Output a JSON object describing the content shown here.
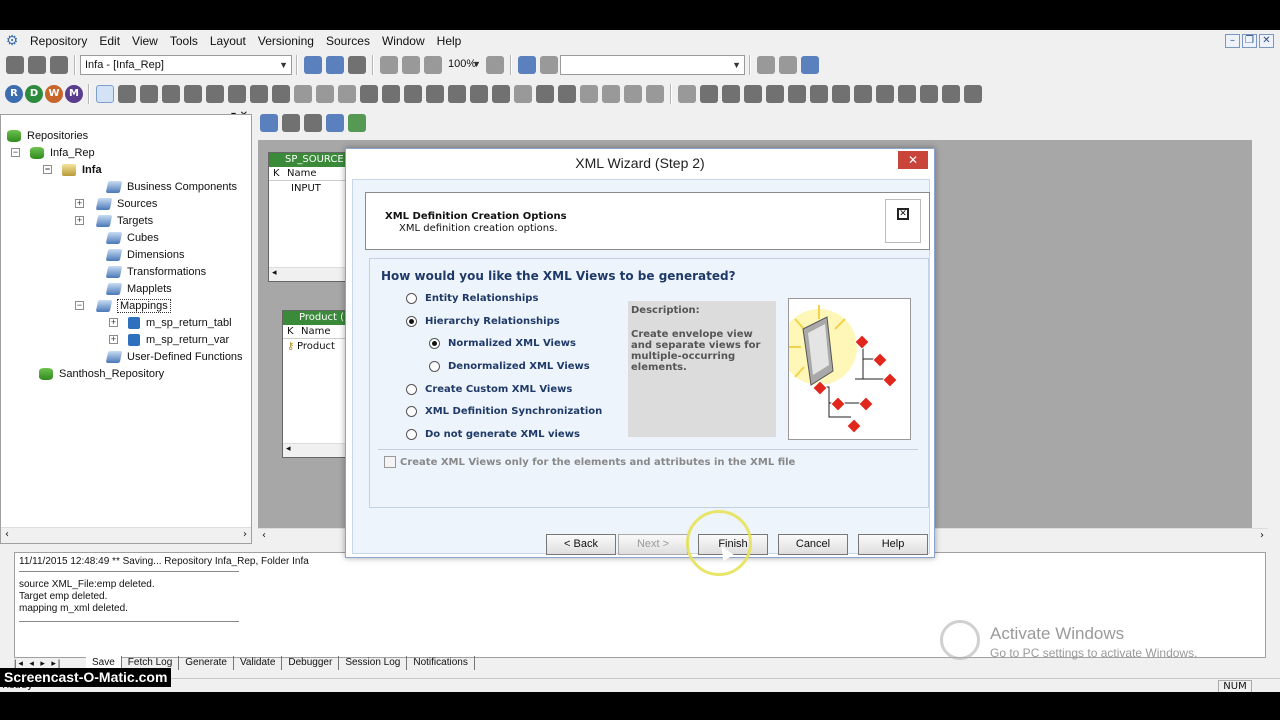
{
  "menubar": {
    "items": [
      "Repository",
      "Edit",
      "View",
      "Tools",
      "Layout",
      "Versioning",
      "Sources",
      "Window",
      "Help"
    ]
  },
  "toolbar": {
    "repo_combo": "Infa - [Infa_Rep]",
    "zoom": "100%",
    "circle_buttons": [
      "R",
      "D",
      "W",
      "M"
    ],
    "circle_colors": [
      "#3b6db0",
      "#2e8b3e",
      "#c8652a",
      "#5a3d8c"
    ]
  },
  "tree": {
    "root": "Repositories",
    "repo": "Infa_Rep",
    "folder": "Infa",
    "items": [
      "Business Components",
      "Sources",
      "Targets",
      "Cubes",
      "Dimensions",
      "Transformations",
      "Mapplets",
      "Mappings"
    ],
    "mappings": [
      "m_sp_return_tabl",
      "m_sp_return_var"
    ],
    "udf": "User-Defined Functions",
    "repo2": "Santhosh_Repository"
  },
  "workspace": {
    "src1_title": "SP_SOURCE",
    "src1_col_k": "K",
    "src1_col_name": "Name",
    "src1_row": "INPUT",
    "src2_title": "Product (",
    "src2_col_k": "K",
    "src2_col_name": "Name",
    "src2_row": "Product"
  },
  "dialog": {
    "title": "XML Wizard (Step 2)",
    "header_title": "XML Definition Creation Options",
    "header_sub": "XML definition creation options.",
    "question": "How would you like the XML Views to be generated?",
    "options": [
      {
        "label": "Entity Relationships",
        "checked": false
      },
      {
        "label": "Hierarchy Relationships",
        "checked": true
      },
      {
        "label": "Normalized XML Views",
        "checked": true
      },
      {
        "label": "Denormalized XML Views",
        "checked": false
      },
      {
        "label": "Create Custom XML Views",
        "checked": false
      },
      {
        "label": "XML Definition Synchronization",
        "checked": false
      },
      {
        "label": "Do not generate XML views",
        "checked": false
      }
    ],
    "description_label": "Description:",
    "description_text": "Create envelope view and separate views for multiple-occurring elements.",
    "checkbox_label": "Create XML Views only for the elements and attributes in the XML file",
    "buttons": {
      "back": "< Back",
      "next": "Next >",
      "finish": "Finish",
      "cancel": "Cancel",
      "help": "Help"
    }
  },
  "output": {
    "lines": [
      "11/11/2015 12:48:49 ** Saving... Repository Infa_Rep, Folder Infa",
      "source XML_File:emp deleted.",
      "Target emp deleted.",
      "mapping  m_xml deleted."
    ],
    "tabs": [
      "Save",
      "Fetch Log",
      "Generate",
      "Validate",
      "Debugger",
      "Session Log",
      "Notifications"
    ]
  },
  "status": {
    "ready": "Ready",
    "num": "NUM"
  },
  "watermark": "Screencast-O-Matic.com",
  "activate": {
    "title": "Activate Windows",
    "sub": "Go to PC settings to activate Windows."
  }
}
